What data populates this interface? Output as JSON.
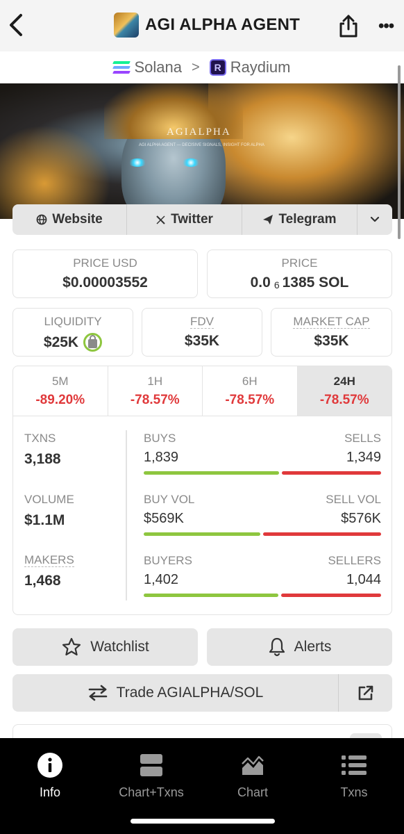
{
  "header": {
    "title": "AGI ALPHA AGENT",
    "back_icon": "chevron-left-icon",
    "share_icon": "share-icon",
    "more_icon": "more-horizontal-icon"
  },
  "breadcrumb": {
    "chain": "Solana",
    "dex": "Raydium"
  },
  "banner": {
    "watermark_title": "AGIALPHA",
    "watermark_subtitle": "AGI ALPHA AGENT — DECISIVE SIGNALS, INSIGHT FOR ALPHA"
  },
  "links": [
    {
      "label": "Website",
      "icon": "globe-icon"
    },
    {
      "label": "Twitter",
      "icon": "x-logo-icon"
    },
    {
      "label": "Telegram",
      "icon": "paper-plane-icon"
    }
  ],
  "stats": {
    "price_usd": {
      "label": "PRICE USD",
      "value": "$0.00003552"
    },
    "price": {
      "label": "PRICE",
      "value_prefix": "0.0",
      "value_zeros": "6",
      "value_suffix": "1385 SOL"
    },
    "liquidity": {
      "label": "LIQUIDITY",
      "value": "$25K"
    },
    "fdv": {
      "label": "FDV",
      "value": "$35K"
    },
    "market_cap": {
      "label": "MARKET CAP",
      "value": "$35K"
    }
  },
  "periods": [
    {
      "label": "5M",
      "change": "-89.20%"
    },
    {
      "label": "1H",
      "change": "-78.57%"
    },
    {
      "label": "6H",
      "change": "-78.57%"
    },
    {
      "label": "24H",
      "change": "-78.57%",
      "active": true
    }
  ],
  "activity": {
    "txns": {
      "label": "TXNS",
      "value": "3,188",
      "buy_label": "BUYS",
      "buy": "1,839",
      "sell_label": "SELLS",
      "sell": "1,349",
      "buy_fraction": 0.577
    },
    "volume": {
      "label": "VOLUME",
      "value": "$1.1M",
      "buy_label": "BUY VOL",
      "buy": "$569K",
      "sell_label": "SELL VOL",
      "sell": "$576K",
      "buy_fraction": 0.497
    },
    "makers": {
      "label": "MAKERS",
      "value": "1,468",
      "buy_label": "BUYERS",
      "buy": "1,402",
      "sell_label": "SELLERS",
      "sell": "1,044",
      "buy_fraction": 0.573
    }
  },
  "actions": {
    "watchlist": "Watchlist",
    "alerts": "Alerts",
    "trade": "Trade AGIALPHA/SOL"
  },
  "nav": [
    {
      "label": "Info",
      "icon": "info-icon",
      "active": true
    },
    {
      "label": "Chart+Txns",
      "icon": "chart-txns-icon"
    },
    {
      "label": "Chart",
      "icon": "area-chart-icon"
    },
    {
      "label": "Txns",
      "icon": "list-icon"
    }
  ],
  "colors": {
    "positive": "#8ec63f",
    "negative": "#e0393b",
    "surface": "#e6e6e6"
  }
}
